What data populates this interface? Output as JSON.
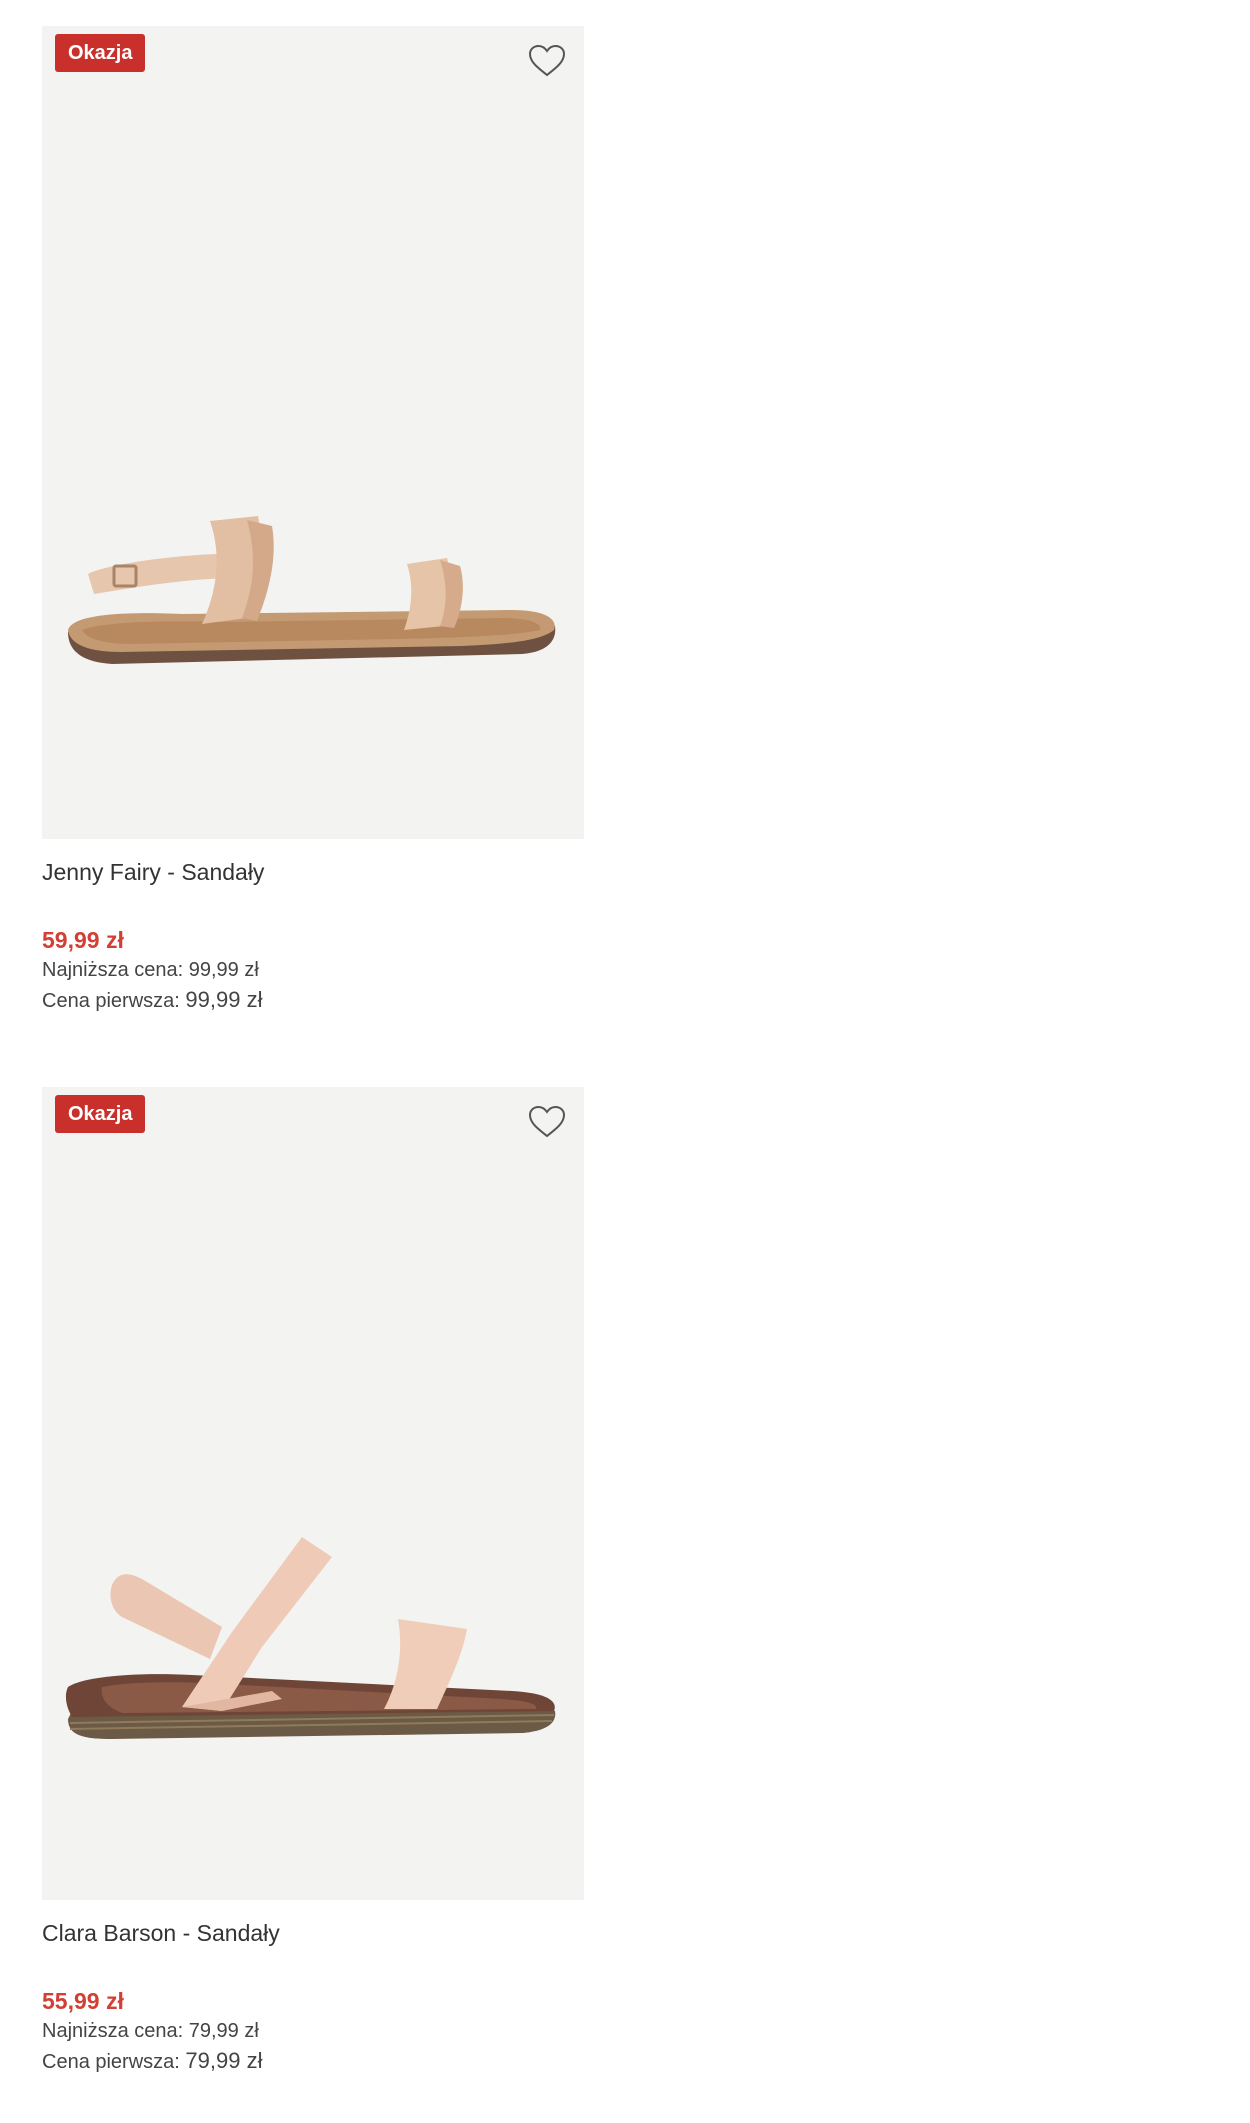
{
  "colors": {
    "badge": "#c9302c",
    "price": "#d23f35",
    "image_bg": "#f3f3f2"
  },
  "products": [
    {
      "badge": "Okazja",
      "title": "Jenny Fairy - Sandały",
      "price": "59,99 zł",
      "lowest_label": "Najniższa cena:",
      "lowest_value": "99,99 zł",
      "first_label": "Cena pierwsza:",
      "first_value": "99,99 zł",
      "favorite_icon": "heart-outline-icon"
    },
    {
      "badge": "Okazja",
      "title": "Clara Barson - Sandały",
      "price": "55,99 zł",
      "lowest_label": "Najniższa cena:",
      "lowest_value": "79,99 zł",
      "first_label": "Cena pierwsza:",
      "first_value": "79,99 zł",
      "favorite_icon": "heart-outline-icon"
    }
  ]
}
